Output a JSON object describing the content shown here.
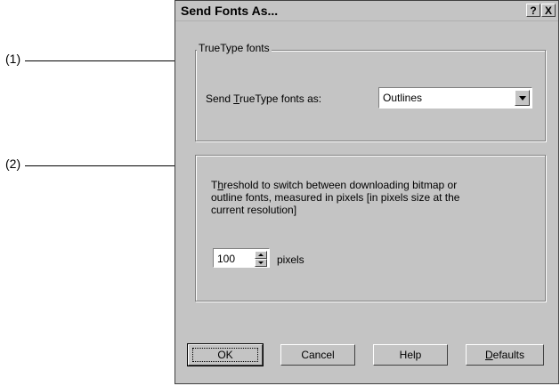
{
  "callouts": {
    "one": "(1)",
    "two": "(2)"
  },
  "dialog": {
    "title": "Send Fonts As...",
    "help_button": "?",
    "close_button": "X"
  },
  "truetype_group": {
    "legend": "TrueType fonts",
    "label_prefix": "Send ",
    "label_mnemonic": "T",
    "label_rest": "rueType fonts as:",
    "selected": "Outlines"
  },
  "threshold_group": {
    "line1_prefix": "T",
    "line1_mnemonic": "h",
    "line1_rest": "reshold to switch between downloading bitmap or",
    "line2": "outline fonts, measured in pixels [in pixels size at the",
    "line3": "current resolution]",
    "value": "100",
    "unit": "pixels"
  },
  "buttons": {
    "ok": "OK",
    "cancel": "Cancel",
    "help": "Help",
    "defaults_mnemonic": "D",
    "defaults_rest": "efaults"
  },
  "colors": {
    "face": "#c4c4c4",
    "shadow": "#808080",
    "highlight": "#ffffff",
    "dark": "#404040"
  },
  "icons": [
    "help-icon",
    "close-icon",
    "dropdown-arrow-icon",
    "spin-up-icon",
    "spin-down-icon"
  ]
}
